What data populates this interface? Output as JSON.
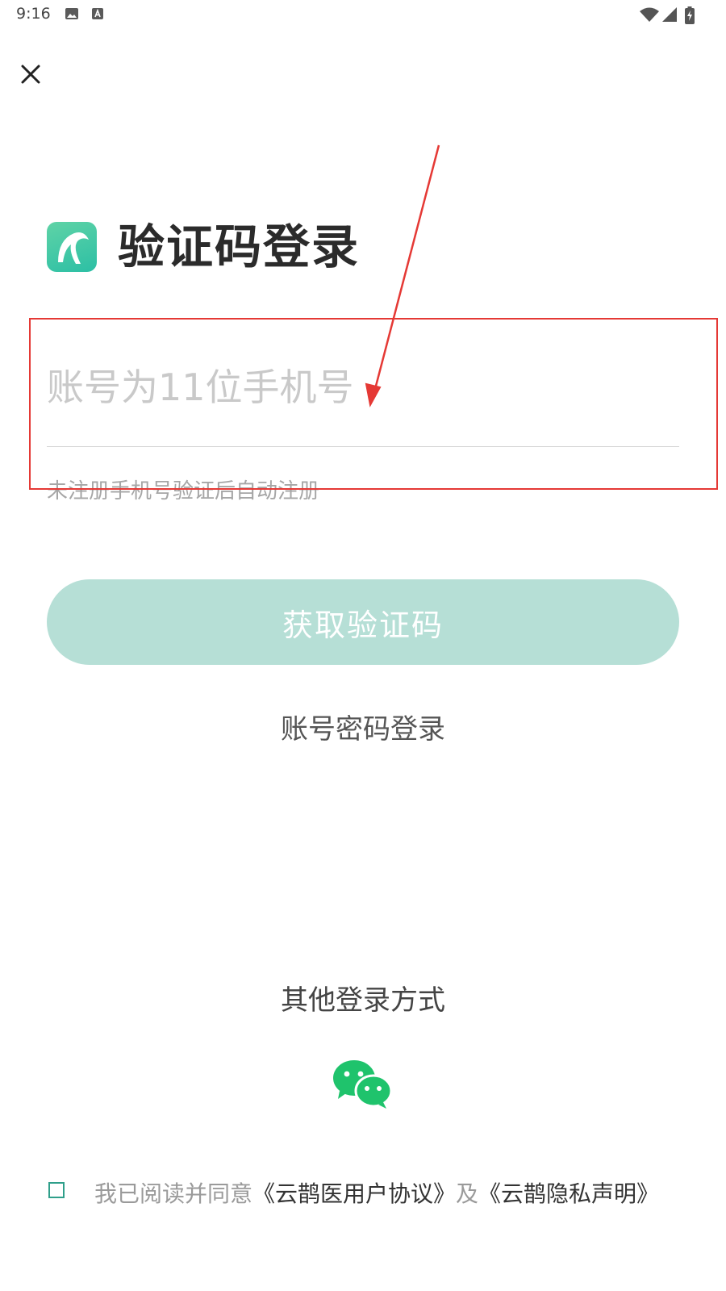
{
  "status_bar": {
    "time": "9:16"
  },
  "login": {
    "title": "验证码登录",
    "phone_placeholder": "账号为11位手机号",
    "phone_value": "",
    "hint": "未注册手机号验证后自动注册",
    "get_code_label": "获取验证码",
    "password_login_label": "账号密码登录",
    "other_login_label": "其他登录方式"
  },
  "agreement": {
    "prefix": "我已阅读并同意",
    "user_agreement": "《云鹊医用户协议》",
    "and": "及",
    "privacy": "《云鹊隐私声明》"
  },
  "icons": {
    "close": "close-icon",
    "wechat": "wechat-icon",
    "app_logo": "app-logo-icon",
    "gallery": "image-icon",
    "a_notice": "a-notification-icon",
    "wifi": "wifi-icon",
    "signal": "signal-icon",
    "battery": "battery-charging-icon"
  },
  "colors": {
    "brand": "#2cbfa5",
    "button_disabled": "#b6dfd6",
    "wechat": "#1fc36c",
    "annotation": "#e53935"
  }
}
